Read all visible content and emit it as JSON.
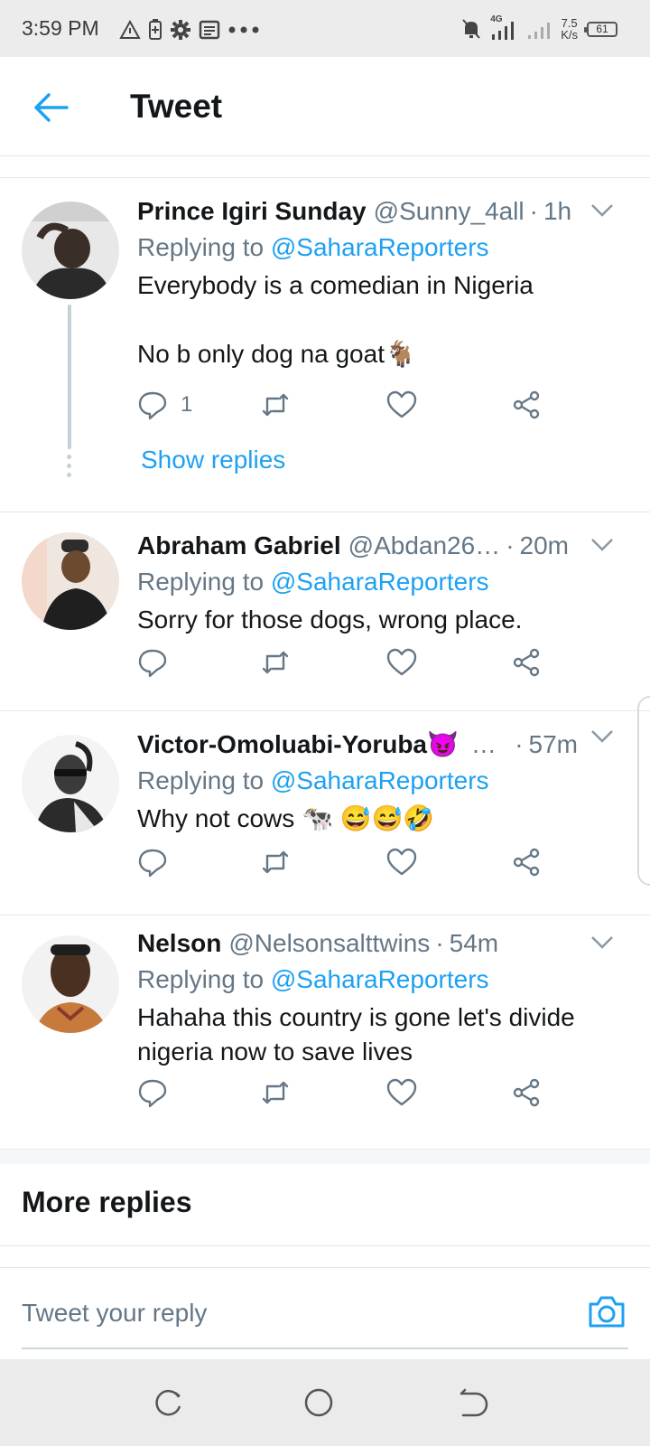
{
  "status_bar": {
    "time": "3:59 PM",
    "network_label": "4G",
    "speed_value": "7.5",
    "speed_unit": "K/s",
    "battery": "61"
  },
  "header": {
    "title": "Tweet"
  },
  "tweets": [
    {
      "name": "Prince Igiri Sunday",
      "handle": "@Sunny_4all",
      "time": "1h",
      "reply_prefix": "Replying to",
      "reply_to": "@SaharaReporters",
      "text": "Everybody is a comedian in Nigeria\n\nNo b only dog na  goat🐐",
      "reply_count": "1",
      "show_replies": "Show replies"
    },
    {
      "name": "Abraham Gabriel",
      "handle": "@Abdan26…",
      "time": "20m",
      "reply_prefix": "Replying to",
      "reply_to": "@SaharaReporters",
      "text": "Sorry for those dogs, wrong place."
    },
    {
      "name": "Victor-Omoluabi-Yoruba😈",
      "handle": "…",
      "time": "57m",
      "reply_prefix": "Replying to",
      "reply_to": "@SaharaReporters",
      "text": "Why not cows 🐄 😅😅🤣"
    },
    {
      "name": "Nelson",
      "handle": "@Nelsonsalttwins",
      "time": "54m",
      "reply_prefix": "Replying to",
      "reply_to": "@SaharaReporters",
      "text": "Hahaha this country is gone let's divide nigeria now to save lives"
    }
  ],
  "more_replies": "More replies",
  "compose": {
    "placeholder": "Tweet your reply"
  },
  "colors": {
    "accent": "#1da1f2",
    "secondary_text": "#657786",
    "divider": "#e1e8ed"
  }
}
